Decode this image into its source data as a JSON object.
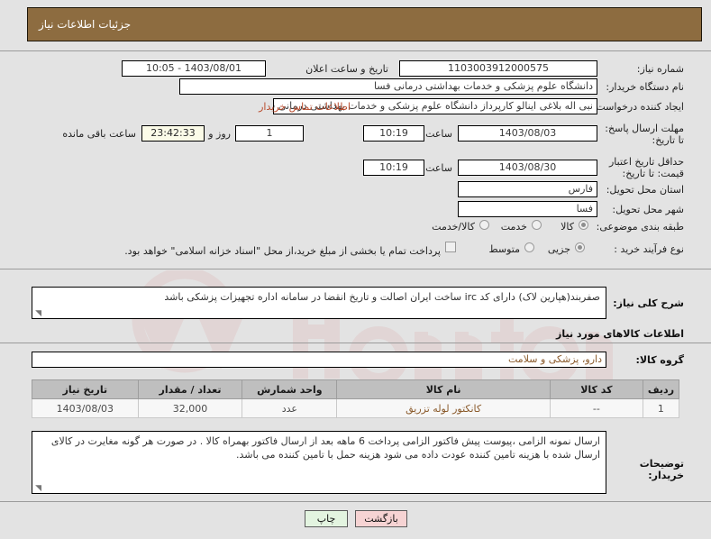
{
  "header": {
    "title": "جزئیات اطلاعات نیاز"
  },
  "fields": {
    "need_number_label": "شماره نیاز:",
    "need_number_value": "1103003912000575",
    "public_announce_label": "تاریخ و ساعت اعلان عمومی:",
    "public_announce_value": "1403/08/01 - 10:05",
    "buyer_org_label": "نام دستگاه خریدار:",
    "buyer_org_value": "دانشگاه علوم پزشکی و خدمات بهداشتی درمانی فسا",
    "creator_label": "ایجاد کننده درخواست:",
    "creator_value": "نبی اله بلاغی اینالو کارپرداز دانشگاه علوم پزشکی و خدمات بهداشتی درمانی ف",
    "contact_link": "اطلاعات تماس خریدار",
    "answer_deadline_label": "مهلت ارسال پاسخ: تا تاریخ:",
    "answer_deadline_date": "1403/08/03",
    "answer_deadline_hour_label": "ساعت",
    "answer_deadline_time": "10:19",
    "days_remaining": "1",
    "days_label": "روز و",
    "countdown": "23:42:33",
    "countdown_suffix": "ساعت باقی مانده",
    "price_validity_label": "حداقل تاریخ اعتبار قیمت: تا تاریخ:",
    "price_validity_date": "1403/08/30",
    "price_validity_hour_label": "ساعت",
    "price_validity_time": "10:19",
    "province_label": "استان محل تحویل:",
    "province_value": "فارس",
    "city_label": "شهر محل تحویل:",
    "city_value": "فسا",
    "subject_class_label": "طبقه بندی موضوعی:",
    "purchase_type_label": "نوع فرآیند خرید :"
  },
  "subject_options": [
    {
      "label": "کالا",
      "selected": true
    },
    {
      "label": "خدمت",
      "selected": false
    },
    {
      "label": "کالا/خدمت",
      "selected": false
    }
  ],
  "purchase_options": [
    {
      "label": "جزیی",
      "selected": true
    },
    {
      "label": "متوسط",
      "selected": false
    }
  ],
  "treasury_checkbox": {
    "checked": false,
    "label": "پرداخت تمام یا بخشی از مبلغ خرید،از محل \"اسناد خزانه اسلامی\" خواهد بود."
  },
  "need_description": {
    "label": "شرح کلی نیاز:",
    "value": "صفربند(هپارین لاک)  دارای کد irc ساخت ایران  اصالت و تاریخ انقضا در سامانه اداره تجهیزات پزشکی باشد"
  },
  "goods_section": {
    "heading": "اطلاعات کالاهای مورد نیاز",
    "group_label": "گروه کالا:",
    "group_value": "دارو، پزشکی و سلامت"
  },
  "table": {
    "headers": [
      "ردیف",
      "کد کالا",
      "نام کالا",
      "واحد شمارش",
      "تعداد / مقدار",
      "تاریخ نیاز"
    ],
    "rows": [
      {
        "row": "1",
        "code": "--",
        "name": "کانکتور لوله تزریق",
        "unit": "عدد",
        "qty": "32,000",
        "date": "1403/08/03"
      }
    ]
  },
  "buyer_notes": {
    "label": "توضیحات خریدار:",
    "value": "ارسال نمونه الزامی ،پیوست پیش فاکتور الزامی پرداخت 6 ماهه بعد از ارسال فاکتور بهمراه کالا . در صورت هر گونه مغایرت در کالای ارسال شده با هزینه تامین کننده  عودت داده می شود  هزینه حمل با تامین  کننده می باشد."
  },
  "footer": {
    "back_label": "بازگشت",
    "print_label": "چاپ"
  },
  "colors": {
    "header_bg": "#8d6c40",
    "link": "#b94c2e",
    "timer_bg": "#fbfbe8",
    "back_btn": "#f6d3d3",
    "print_btn": "#e3f4e0",
    "table_header": "#bfbfbf"
  },
  "watermark": {
    "text": "tender.net"
  }
}
